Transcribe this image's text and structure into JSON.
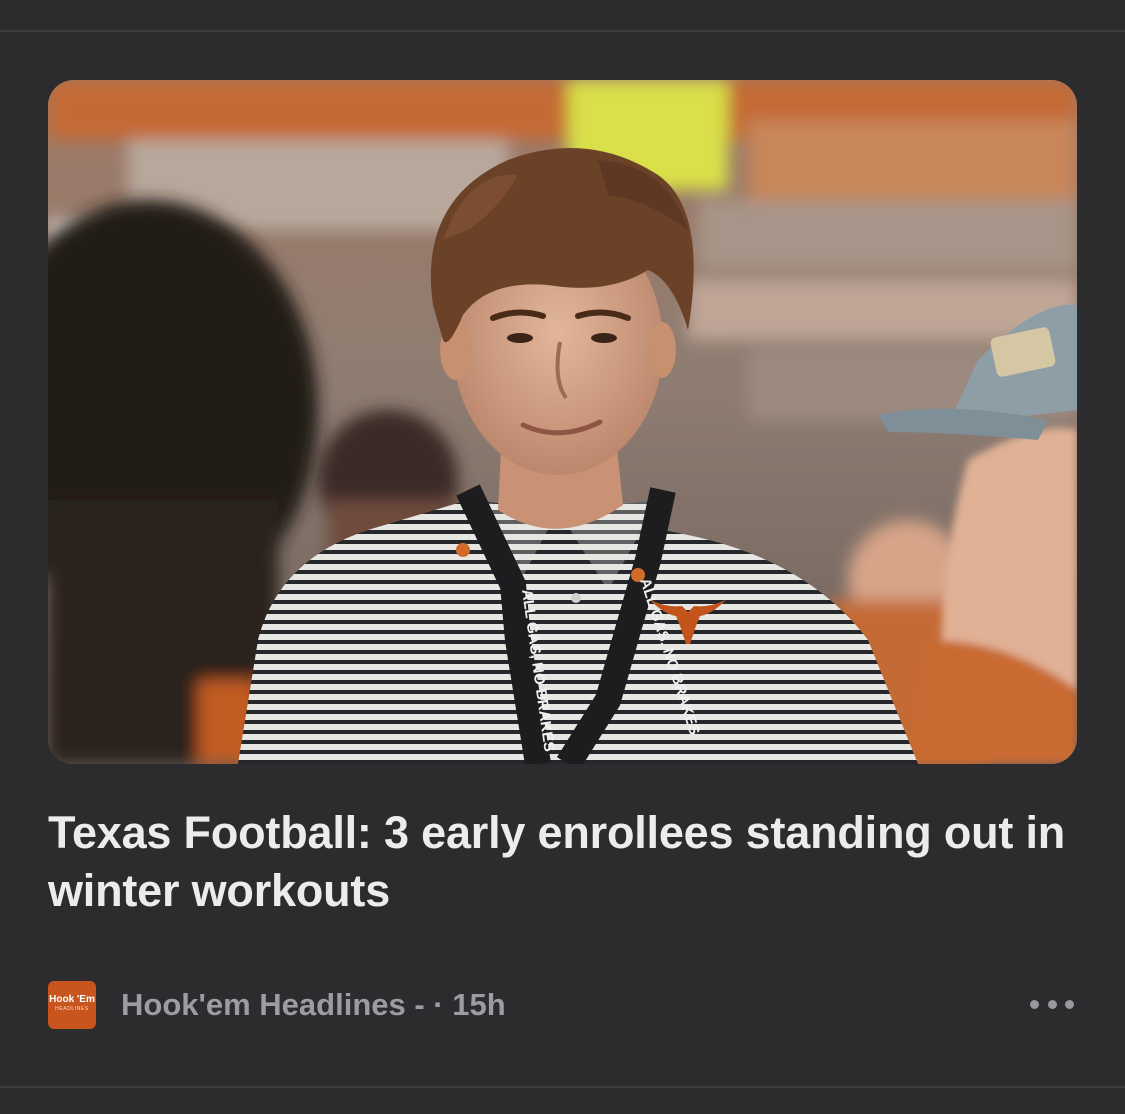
{
  "article": {
    "headline": "Texas Football: 3 early enrollees standing out in winter workouts",
    "image_alt": "Young man in a striped polo wearing an ALL GAS, NO BRAKES lanyard at a Texas stadium",
    "lanyard_text": "ALL GAS, NO BRAKES"
  },
  "source": {
    "name": "Hook'em Headlines - · 15h",
    "logo_top": "Hook 'Em",
    "logo_bottom": "HEADLINES",
    "logo_color": "#c8541e"
  },
  "actions": {
    "more_icon": "ellipsis-icon"
  },
  "colors": {
    "background": "#2c2c2e",
    "headline": "#ececee",
    "meta": "#9c9ca1",
    "burnt_orange": "#bf5700"
  }
}
